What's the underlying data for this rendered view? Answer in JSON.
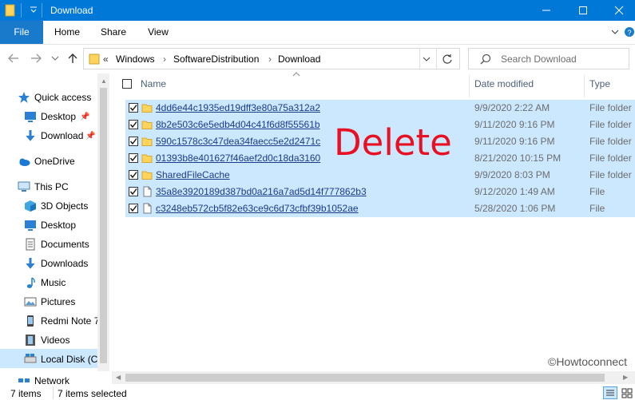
{
  "window": {
    "title": "Download"
  },
  "ribbon": {
    "tabs": [
      "File",
      "Home",
      "Share",
      "View"
    ]
  },
  "address": {
    "prefix": "«",
    "crumbs": [
      "Windows",
      "SoftwareDistribution",
      "Download"
    ],
    "search_placeholder": "Search Download"
  },
  "nav": {
    "quick_access": "Quick access",
    "desktop_pinned": "Desktop",
    "downloads_pinned": "Download",
    "onedrive": "OneDrive",
    "this_pc": "This PC",
    "objects3d": "3D Objects",
    "desktop": "Desktop",
    "documents": "Documents",
    "downloads": "Downloads",
    "music": "Music",
    "pictures": "Pictures",
    "redmi": "Redmi Note 7",
    "videos": "Videos",
    "localdisk": "Local Disk (C:)",
    "network": "Network"
  },
  "columns": {
    "name": "Name",
    "date": "Date modified",
    "type": "Type"
  },
  "files": [
    {
      "name": "4dd6e44c1935ed19dff3e80a75a312a2",
      "date": "9/9/2020 2:22 AM",
      "type": "File folder"
    },
    {
      "name": "8b2e503c6e5edb4d04c41f6d8f55561b",
      "date": "9/11/2020 9:16 PM",
      "type": "File folder"
    },
    {
      "name": "590c1578c3c47dea34faecc5e2d2471c",
      "date": "9/11/2020 9:16 PM",
      "type": "File folder"
    },
    {
      "name": "01393b8e401627f46aef2d0c18da3160",
      "date": "8/21/2020 10:15 PM",
      "type": "File folder"
    },
    {
      "name": "SharedFileCache",
      "date": "9/9/2020 8:03 PM",
      "type": "File folder"
    },
    {
      "name": "35a8e3920189d387bd0a216a7ad5d14f777862b3",
      "date": "9/12/2020 1:49 AM",
      "type": "File"
    },
    {
      "name": "c3248eb572cb5f82e63ce9c6d73cfbf39b1052ae",
      "date": "5/28/2020 1:06 PM",
      "type": "File"
    }
  ],
  "overlay": {
    "delete": "Delete",
    "watermark": "©Howtoconnect"
  },
  "status": {
    "items": "7 items",
    "selected": "7 items selected"
  },
  "colors": {
    "accent": "#0078d7",
    "selection": "#cce8ff",
    "overlay_red": "#e81123"
  }
}
